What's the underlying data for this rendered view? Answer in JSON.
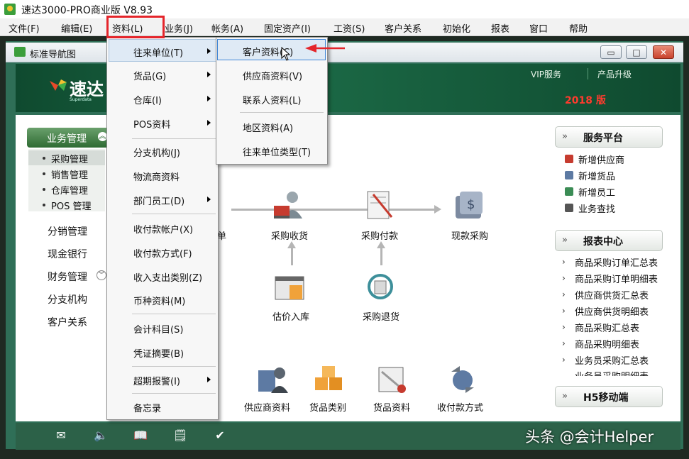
{
  "window": {
    "title": "速达3000-PRO商业版 V8.93"
  },
  "menubar": {
    "items": [
      "文件(F)",
      "编辑(E)",
      "资料(L)",
      "业务(J)",
      "帐务(A)",
      "固定资产(I)",
      "工资(S)",
      "客户关系",
      "初始化",
      "报表",
      "窗口",
      "帮助"
    ]
  },
  "inner_window": {
    "title": "标准导航图",
    "min_label": "▭",
    "max_label": "□",
    "close_label": "✕"
  },
  "banner": {
    "logo_text": "速达",
    "logo_sub": "Superdata",
    "vip": "VIP服务",
    "upgrade": "产品升级",
    "edition": "2018 版"
  },
  "sidebar": {
    "header": "业务管理",
    "sub_items": [
      "采购管理",
      "销售管理",
      "仓库管理",
      "POS 管理"
    ],
    "items": [
      "分销管理",
      "现金银行",
      "财务管理",
      "分支机构",
      "客户关系"
    ]
  },
  "flow": {
    "row1": [
      "采购收货",
      "采购付款",
      "现款采购"
    ],
    "row1_partial": "单",
    "row2": [
      "估价入库",
      "采购退货"
    ],
    "row3": [
      "供应商资料",
      "货品类别",
      "货品资料",
      "收付款方式"
    ]
  },
  "right_panel": {
    "service_title": "服务平台",
    "service_links": [
      "新增供应商",
      "新增货品",
      "新增员工",
      "业务查找"
    ],
    "report_title": "报表中心",
    "reports": [
      "商品采购订单汇总表",
      "商品采购订单明细表",
      "供应商供货汇总表",
      "供应商供货明细表",
      "商品采购汇总表",
      "商品采购明细表",
      "业务员采购汇总表",
      "业务员采购明细表"
    ],
    "h5_title": "H5移动端",
    "chevron": "»"
  },
  "menu_main": {
    "items": [
      {
        "label": "往来单位(T)",
        "sub": true
      },
      {
        "label": "货品(G)",
        "sub": true
      },
      {
        "label": "仓库(I)",
        "sub": true
      },
      {
        "label": "POS资料",
        "sub": true
      },
      {
        "label": "分支机构(J)",
        "sub": false
      },
      {
        "label": "物流商资料",
        "sub": false
      },
      {
        "label": "部门员工(D)",
        "sub": true
      },
      {
        "label": "收付款帐户(X)",
        "sub": false
      },
      {
        "label": "收付款方式(F)",
        "sub": false
      },
      {
        "label": "收入支出类别(Z)",
        "sub": false
      },
      {
        "label": "币种资料(M)",
        "sub": false
      },
      {
        "label": "会计科目(S)",
        "sub": false
      },
      {
        "label": "凭证摘要(B)",
        "sub": false
      },
      {
        "label": "超期报警(I)",
        "sub": true
      },
      {
        "label": "备忘录",
        "sub": false
      }
    ]
  },
  "menu_sub": {
    "items": [
      "客户资料(C)",
      "供应商资料(V)",
      "联系人资料(L)",
      "地区资料(A)",
      "往来单位类型(T)"
    ]
  },
  "bottom_icons": [
    "✉",
    "🔈",
    "📖",
    "🗒",
    "✔"
  ],
  "watermark": "头条 @会计Helper",
  "colors": {
    "accent_red": "#e4252b",
    "dark_green": "#2c6148",
    "edition_red": "#ff3b2e"
  }
}
